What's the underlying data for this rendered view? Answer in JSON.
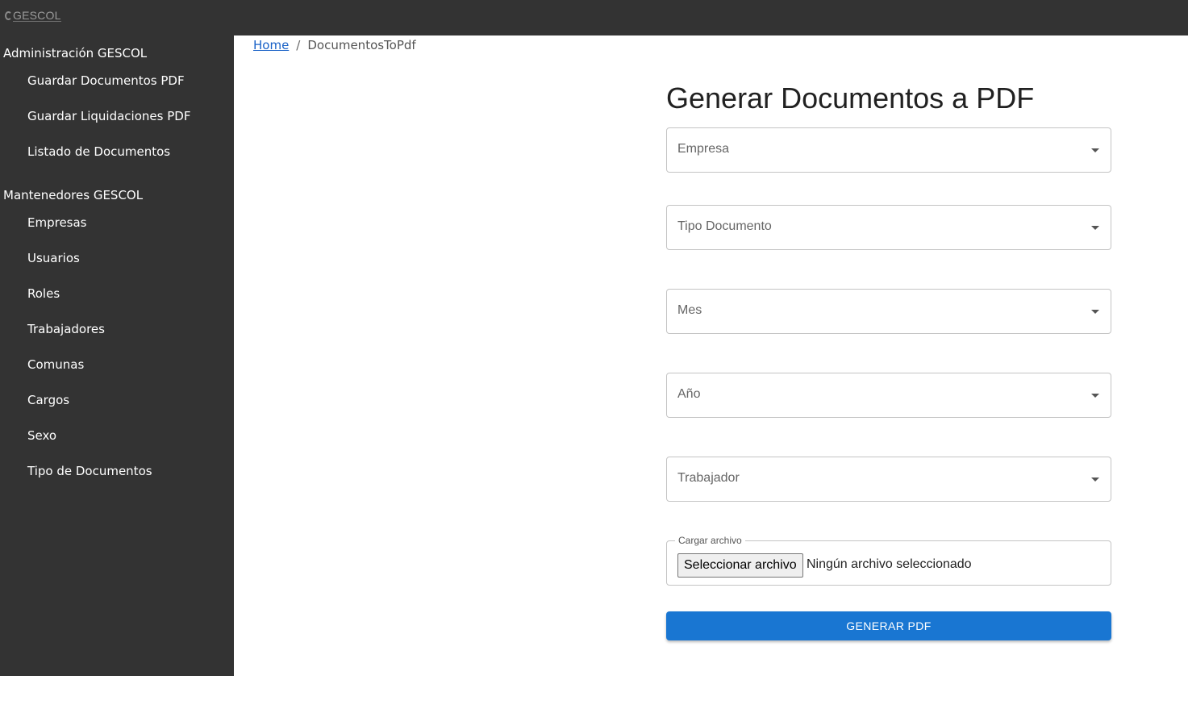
{
  "app": {
    "logo_text": "GESCOL"
  },
  "sidebar": {
    "sections": [
      {
        "title": "Administración GESCOL",
        "items": [
          "Guardar Documentos PDF",
          "Guardar Liquidaciones PDF",
          "Listado de Documentos"
        ]
      },
      {
        "title": "Mantenedores GESCOL",
        "items": [
          "Empresas",
          "Usuarios",
          "Roles",
          "Trabajadores",
          "Comunas",
          "Cargos",
          "Sexo",
          "Tipo de Documentos"
        ]
      }
    ]
  },
  "breadcrumb": {
    "home": "Home",
    "separator": "/",
    "current": "DocumentosToPdf"
  },
  "form": {
    "title": "Generar Documentos a PDF",
    "fields": [
      "Empresa",
      "Tipo Documento",
      "Mes",
      "Año",
      "Trabajador"
    ],
    "upload": {
      "label": "Cargar archivo",
      "button": "Seleccionar archivo",
      "status": "Ningún archivo seleccionado"
    },
    "submit": "GENERAR PDF"
  },
  "colors": {
    "sidebar_bg": "#333333",
    "primary": "#1976d2",
    "link": "#1a62c7"
  }
}
